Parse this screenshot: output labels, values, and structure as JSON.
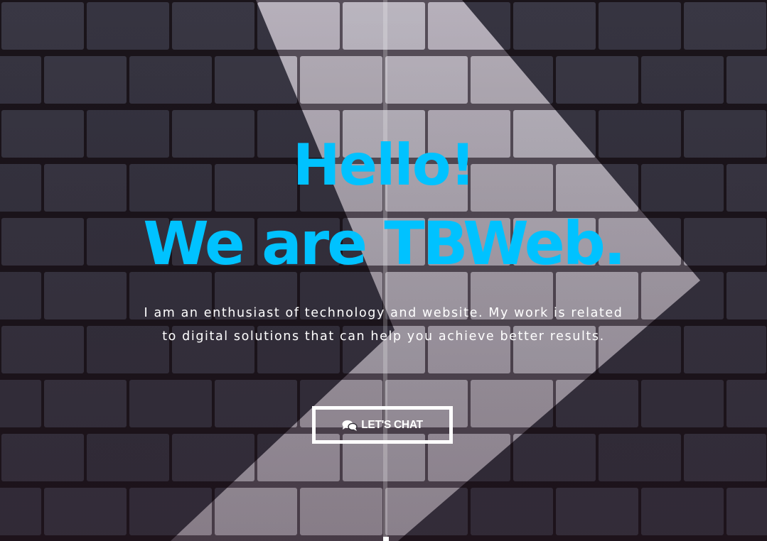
{
  "hero": {
    "headline_line1": "Hello!",
    "headline_line2": "We are TBWeb.",
    "tagline": "I am an enthusiast of technology and website. My work is related to digital solutions that can help you achieve better results.",
    "cta_label": "LET'S CHAT",
    "cta_icon": "chat-bubbles-icon",
    "background": "brick wall with painted white chevron arrow"
  },
  "colors": {
    "accent": "#00c2ff",
    "text": "#ffffff",
    "brick_dark": "#3d3b48",
    "brick_light": "#cdc8d2",
    "mortar": "#1b141a"
  }
}
